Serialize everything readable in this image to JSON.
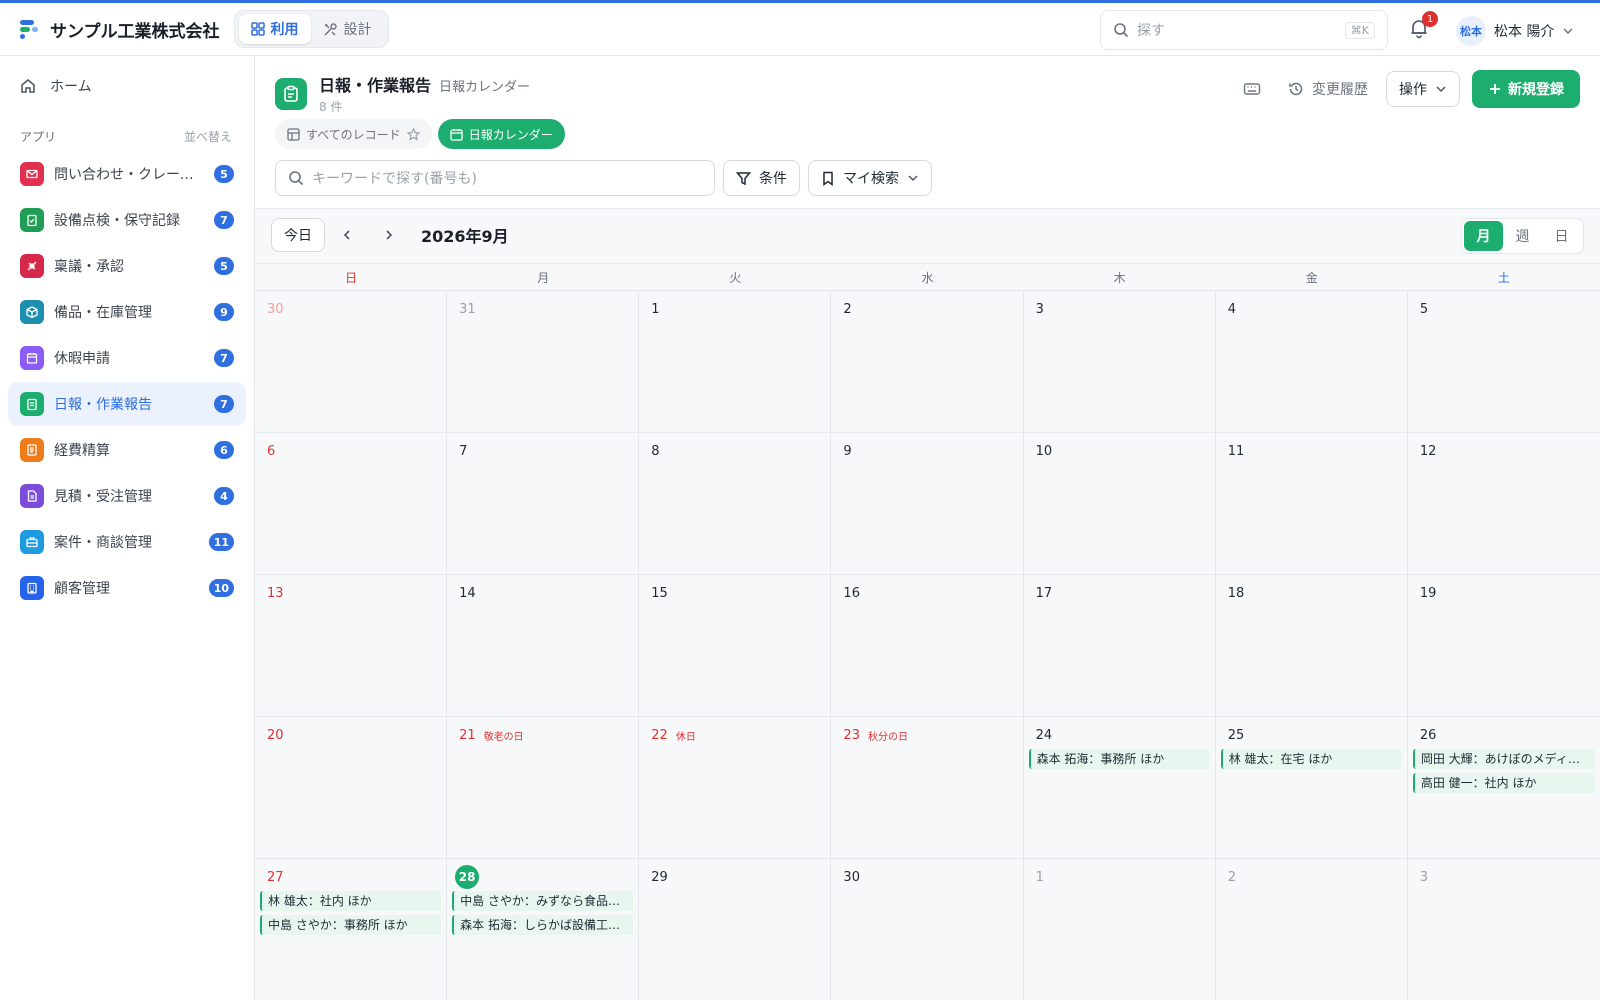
{
  "header": {
    "company": "サンプル工業株式会社",
    "modes": [
      {
        "label": "利用",
        "active": true,
        "icon": "grid-icon"
      },
      {
        "label": "設計",
        "active": false,
        "icon": "tools-icon"
      }
    ],
    "search_placeholder": "探す",
    "search_shortcut": "⌘K",
    "notification_count": "1",
    "user_initials": "松本",
    "user_name": "松本 陽介"
  },
  "sidebar": {
    "home_label": "ホーム",
    "apps_label": "アプリ",
    "sort_label": "並べ替え",
    "apps": [
      {
        "label": "問い合わせ・クレーム管理",
        "count": "5",
        "color": "#e03151",
        "icon": "mail-icon",
        "active": false
      },
      {
        "label": "設備点検・保守記録",
        "count": "7",
        "color": "#1f9d55",
        "icon": "clipboard-check-icon",
        "active": false
      },
      {
        "label": "稟議・承認",
        "count": "5",
        "color": "#d6284b",
        "icon": "stamp-icon",
        "active": false
      },
      {
        "label": "備品・在庫管理",
        "count": "9",
        "color": "#1c8fb0",
        "icon": "box-icon",
        "active": false
      },
      {
        "label": "休暇申請",
        "count": "7",
        "color": "#8b5cf6",
        "icon": "calendar-icon",
        "active": false
      },
      {
        "label": "日報・作業報告",
        "count": "7",
        "color": "#1dae6f",
        "icon": "clipboard-icon",
        "active": true
      },
      {
        "label": "経費精算",
        "count": "6",
        "color": "#ef7b1a",
        "icon": "receipt-icon",
        "active": false
      },
      {
        "label": "見積・受注管理",
        "count": "4",
        "color": "#7c4ddb",
        "icon": "document-icon",
        "active": false
      },
      {
        "label": "案件・商談管理",
        "count": "11",
        "color": "#1e9be0",
        "icon": "briefcase-icon",
        "active": false
      },
      {
        "label": "顧客管理",
        "count": "10",
        "color": "#2563eb",
        "icon": "building-icon",
        "active": false
      }
    ]
  },
  "page": {
    "title": "日報・作業報告",
    "subtitle": "日報カレンダー",
    "count": "8 件",
    "history_label": "変更履歴",
    "ops_label": "操作",
    "new_label": "新規登録",
    "views": [
      {
        "label": "すべてのレコード",
        "active": false
      },
      {
        "label": "日報カレンダー",
        "active": true
      }
    ],
    "keyword_placeholder": "キーワードで探す(番号も)",
    "condition_label": "条件",
    "my_search_label": "マイ検索"
  },
  "calendar": {
    "today_label": "今日",
    "month_label": "2026年9月",
    "view_modes": [
      {
        "label": "月",
        "active": true
      },
      {
        "label": "週",
        "active": false
      },
      {
        "label": "日",
        "active": false
      }
    ],
    "weekdays": [
      "日",
      "月",
      "火",
      "水",
      "木",
      "金",
      "土"
    ],
    "days": [
      {
        "d": "30",
        "muted": true,
        "sun": true
      },
      {
        "d": "31",
        "muted": true
      },
      {
        "d": "1"
      },
      {
        "d": "2"
      },
      {
        "d": "3"
      },
      {
        "d": "4"
      },
      {
        "d": "5"
      },
      {
        "d": "6",
        "sun": true
      },
      {
        "d": "7"
      },
      {
        "d": "8"
      },
      {
        "d": "9"
      },
      {
        "d": "10"
      },
      {
        "d": "11"
      },
      {
        "d": "12"
      },
      {
        "d": "13",
        "sun": true
      },
      {
        "d": "14"
      },
      {
        "d": "15"
      },
      {
        "d": "16"
      },
      {
        "d": "17"
      },
      {
        "d": "18"
      },
      {
        "d": "19"
      },
      {
        "d": "20",
        "sun": true
      },
      {
        "d": "21",
        "holiday": "敬老の日"
      },
      {
        "d": "22",
        "holiday": "休日"
      },
      {
        "d": "23",
        "holiday": "秋分の日"
      },
      {
        "d": "24",
        "events": [
          "森本 拓海：事務所 ほか"
        ]
      },
      {
        "d": "25",
        "events": [
          "林 雄太：在宅 ほか"
        ]
      },
      {
        "d": "26",
        "events": [
          "岡田 大輝：あけぼのメディカル ほか",
          "高田 健一：社内 ほか"
        ]
      },
      {
        "d": "27",
        "sun": true,
        "events": [
          "林 雄太：社内 ほか",
          "中島 さやか：事務所 ほか"
        ]
      },
      {
        "d": "28",
        "today": true,
        "events": [
          "中島 さやか：みずなら食品株式会社 ほか",
          "森本 拓海：しらかば設備工業 ほか"
        ]
      },
      {
        "d": "29"
      },
      {
        "d": "30"
      },
      {
        "d": "1",
        "muted": true
      },
      {
        "d": "2",
        "muted": true
      },
      {
        "d": "3",
        "muted": true
      }
    ]
  }
}
